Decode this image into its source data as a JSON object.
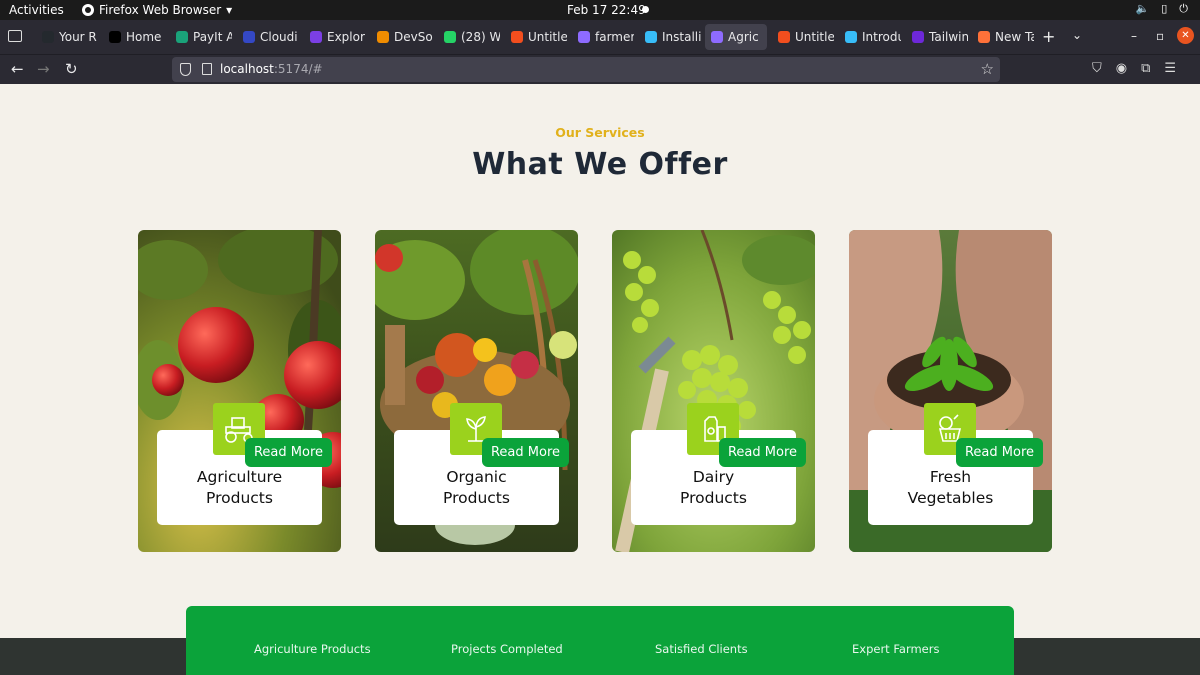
{
  "system_bar": {
    "activities": "Activities",
    "app_name": "Firefox Web Browser",
    "clock": "Feb 17  22:49"
  },
  "browser": {
    "tabs": [
      {
        "label": "Your R",
        "favicon": "github-icon",
        "color": "#24292e"
      },
      {
        "label": "Home /",
        "favicon": "x-icon",
        "color": "#000000"
      },
      {
        "label": "PayIt A",
        "favicon": "payit-icon",
        "color": "#1aa37a"
      },
      {
        "label": "Cloudi",
        "favicon": "cloud-icon",
        "color": "#3448c5"
      },
      {
        "label": "Explor",
        "favicon": "drop-icon",
        "color": "#7b3fe4"
      },
      {
        "label": "DevSol",
        "favicon": "devsol-icon",
        "color": "#f08c00"
      },
      {
        "label": "(28) W",
        "favicon": "whatsapp-icon",
        "color": "#25d366"
      },
      {
        "label": "Untitle",
        "favicon": "figma-icon",
        "color": "#f24e1e"
      },
      {
        "label": "farmer",
        "favicon": "vite-icon",
        "color": "#8e6bff"
      },
      {
        "label": "Installi",
        "favicon": "tailwind-icon",
        "color": "#38bdf8"
      },
      {
        "label": "Agric",
        "favicon": "vite-icon",
        "color": "#8e6bff"
      },
      {
        "label": "Untitle",
        "favicon": "figma-icon",
        "color": "#f24e1e"
      },
      {
        "label": "Introdu",
        "favicon": "tailwind-icon",
        "color": "#38bdf8"
      },
      {
        "label": "Tailwin",
        "favicon": "tailwind-ui-icon",
        "color": "#6d28d9"
      },
      {
        "label": "New Ta",
        "favicon": "firefox-icon",
        "color": "#ff7139"
      }
    ],
    "url_host": "localhost",
    "url_rest": ":5174/#"
  },
  "services": {
    "subtitle": "Our Services",
    "title": "What We Offer",
    "read_more": "Read More",
    "cards": [
      {
        "line1": "Agriculture",
        "line2": "Products",
        "icon": "tractor-icon"
      },
      {
        "line1": "Organic",
        "line2": "Products",
        "icon": "plant-icon"
      },
      {
        "line1": "Dairy",
        "line2": "Products",
        "icon": "milk-icon"
      },
      {
        "line1": "Fresh",
        "line2": "Vegetables",
        "icon": "vegetables-icon"
      }
    ]
  },
  "stats": {
    "items": [
      "Agriculture Products",
      "Projects Completed",
      "Satisfied Clients",
      "Expert Farmers"
    ]
  },
  "colors": {
    "accent_green": "#0ba33a",
    "icon_tile": "#9bd21d",
    "subtitle_gold": "#e1b11b"
  }
}
